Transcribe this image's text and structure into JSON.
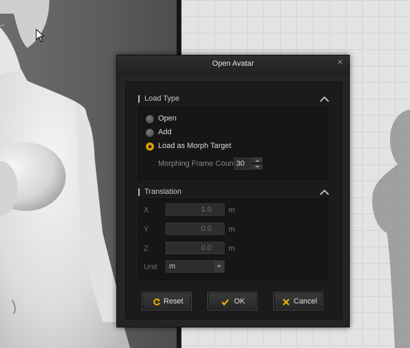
{
  "dialog": {
    "title": "Open Avatar",
    "close_icon": "close-icon",
    "load_type": {
      "header": "Load Type",
      "options": [
        {
          "label": "Open",
          "checked": false
        },
        {
          "label": "Add",
          "checked": false
        },
        {
          "label": "Load as Morph Target",
          "checked": true
        }
      ],
      "frame_count_label": "Morphing Frame Count",
      "frame_count_value": "30"
    },
    "translation": {
      "header": "Translation",
      "fields": [
        {
          "label": "X",
          "value": "1.0",
          "unit": "m"
        },
        {
          "label": "Y",
          "value": "0.0",
          "unit": "m"
        },
        {
          "label": "Z",
          "value": "0.0",
          "unit": "m"
        }
      ],
      "unit_label": "Unit",
      "unit_value": "m"
    },
    "buttons": {
      "reset": "Reset",
      "ok": "OK",
      "cancel": "Cancel"
    }
  },
  "colors": {
    "accent": "#f0b400",
    "dialog_bg": "#242424",
    "grid_bg": "#e3e3e3"
  }
}
